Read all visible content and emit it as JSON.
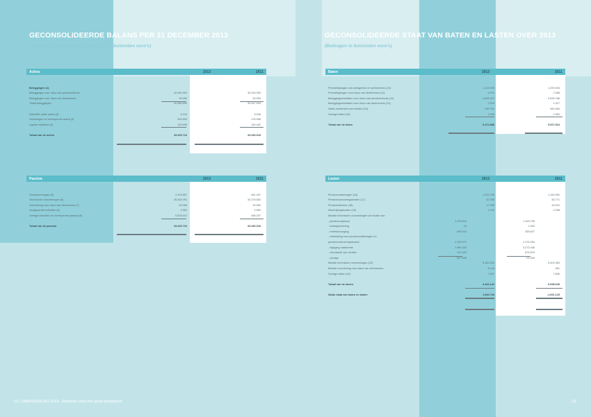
{
  "left": {
    "title": "GECONSOLIDEERDE BALANS PER 31 DECEMBER 2013",
    "subtitle": "(Na resultaatbestemming, bedragen in duizenden euro's)",
    "activa": {
      "header": "Activa",
      "col1": "2013",
      "col2": "2011",
      "rows": [
        {
          "label": "Beleggingen (1)",
          "v1": "",
          "v2": "",
          "bold": true
        },
        {
          "label": "Beleggingen voor risico van pensioenfonds",
          "v1": "42.950.594",
          "v2": "32.916.990"
        },
        {
          "label": "Beleggingen voor risico van deelnemers",
          "v1": "39.096",
          "v2": "30.953"
        },
        {
          "label": "Totaal beleggingen",
          "v1": "42.989.690",
          "v2": "32.947.943"
        },
        {
          "label": "",
          "v1": "",
          "v2": ""
        },
        {
          "label": "Materiële vaste activa (2)",
          "v1": "6.194",
          "v2": "5.946"
        },
        {
          "label": "Vorderingen en overlopende activa (3)",
          "v1": "252.893",
          "v2": "176.538"
        },
        {
          "label": "Liquide middelen (4)",
          "v1": "190.939",
          "v2": "150.492"
        },
        {
          "label": "",
          "v1": "",
          "v2": ""
        },
        {
          "label": "Totaal van de activa",
          "v1": "43.439.716",
          "v2": "33.280.018",
          "bold": true
        }
      ]
    },
    "passiva": {
      "header": "Passiva",
      "col1": "2013",
      "col2": "2011",
      "rows": [
        {
          "label": "Groepsvermogen (5)",
          "v1": "2.423.667",
          "v2": "481.257"
        },
        {
          "label": "Technische voorzieningen (6)",
          "v1": "35.440.091",
          "v2": "32.278.563"
        },
        {
          "label": "Voorziening voor risico van deelnemers (7)",
          "v1": "39.096",
          "v2": "30.953"
        },
        {
          "label": "Langlopende schulden (8)",
          "v1": "2.950",
          "v2": "2.950"
        },
        {
          "label": "Overige schulden en overlopende passiva (9)",
          "v1": "5.533.012",
          "v2": "486.297"
        },
        {
          "label": "",
          "v1": "",
          "v2": ""
        },
        {
          "label": "Totaal van de passiva",
          "v1": "43.439.716",
          "v2": "33.280.018",
          "bold": true
        }
      ]
    },
    "footer": "12 / JAARVERSLAG 2013 - Rekenen voor een goed fundament"
  },
  "right": {
    "title": "GECONSOLIDEERDE STAAT VAN BATEN EN LASTEN OVER 2013",
    "subtitle": "(Bedragen in duizenden euro's)",
    "baten": {
      "header": "Baten",
      "col1": "2013",
      "col2": "2011",
      "rows": [
        {
          "label": "Premiebijdragen van werkgevers en werknemers (10)",
          "v1": "1.123.993",
          "v2": "1.200.003"
        },
        {
          "label": "Premiebijdragen voor risico van deelnemers (11)",
          "v1": "3.970",
          "v2": "7.068"
        },
        {
          "label": "Beleggingsresultaten voor risico van pensioenfonds (12)",
          "v1": "4.992.007",
          "v2": "2.836.788"
        },
        {
          "label": "Beleggingsresultaten voor risico van deelnemers (13)",
          "v1": "2.515",
          "v2": "1.027"
        },
        {
          "label": "Saldo overdracht van rechten (14)",
          "v1": "245.761",
          "v2": "960.984"
        },
        {
          "label": "Overige baten (15)",
          "v1": "1.639",
          "v2": "1.654"
        },
        {
          "label": "",
          "v1": "",
          "v2": ""
        },
        {
          "label": "Totaal van de baten",
          "v1": "6.372.885",
          "v2": "5.007.524",
          "bold": true
        }
      ]
    },
    "lasten": {
      "header": "Lasten",
      "col1": "2013",
      "col2": "2011",
      "rows": [
        {
          "label": "Pensioenuitkeringen (16)",
          "s1": "",
          "v1": "1.192.759",
          "s2": "",
          "v2": "1.182.052"
        },
        {
          "label": "Pensioenuitvoeringskosten (17)",
          "s1": "",
          "v1": "42.935",
          "s2": "",
          "v2": "46.771"
        },
        {
          "label": "Pensioenbeheer (18)",
          "s1": "",
          "v1": "17.098",
          "s2": "",
          "v2": "16.010"
        },
        {
          "label": "Afschrijvingskosten (19)",
          "s1": "",
          "v1": "1.120",
          "s2": "",
          "v2": "2.038"
        },
        {
          "label": "Mutatie technische voorzieningen uit hoofde van:",
          "s1": "",
          "v1": "",
          "s2": "",
          "v2": ""
        },
        {
          "label": "- pensioenopbouw",
          "s1": "1.229.015",
          "v1": "",
          "s2": "1.163.706",
          "v2": ""
        },
        {
          "label": "- toeslagverlening",
          "s1": "29",
          "v1": "",
          "s2": "2.303",
          "v2": ""
        },
        {
          "label": "- rentetoevoeging",
          "s1": "695.015",
          "v1": "",
          "s2": "355.607",
          "v2": ""
        },
        {
          "label": "- onttrekking voor pensioenuitkeringen en",
          "s1": "",
          "v1": "",
          "s2": "",
          "v2": ""
        },
        {
          "label": "pensioenuitvoeringskosten",
          "s1": "-1.190.070",
          "v1": "",
          "s2": "-1.176.264",
          "v2": ""
        },
        {
          "label": "- wijziging marktrente",
          "s1": "1.880.343",
          "v1": "",
          "s2": "4.273.436",
          "v2": ""
        },
        {
          "label": "- overdracht van rechten",
          "s1": "221.402",
          "v1": "",
          "s2": "876.576",
          "v2": ""
        },
        {
          "label": "- overige",
          "s1": "517.995",
          "v1": "",
          "s2": "-91.003",
          "v2": ""
        },
        {
          "label": "Mutatie technische voorzieningen (20)",
          "s1": "",
          "v1": "3.162.429",
          "s2": "",
          "v2": "5.404.353"
        },
        {
          "label": "Mutatie voorziening voor risico van deelnemers",
          "s1": "",
          "v1": "8.144",
          "s2": "",
          "v2": "-351"
        },
        {
          "label": "Overige lasten (21)",
          "s1": "",
          "v1": "7.657",
          "s2": "",
          "v2": "7.806"
        },
        {
          "label": "",
          "s1": "",
          "v1": "",
          "s2": "",
          "v2": ""
        },
        {
          "label": "Totaal van de lasten",
          "s1": "",
          "v1": "4.432.142",
          "s2": "",
          "v2": "6.658.649",
          "bold": true
        },
        {
          "label": "",
          "s1": "",
          "v1": "",
          "s2": "",
          "v2": ""
        },
        {
          "label": "Saldo staat van baten en lasten",
          "s1": "",
          "v1": "1.940.743",
          "s2": "",
          "v2": "-1.651.125",
          "bold": true
        }
      ]
    },
    "footer": "13"
  }
}
